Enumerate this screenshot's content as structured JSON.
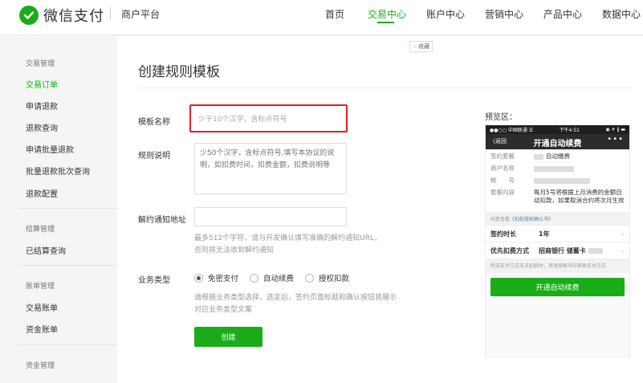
{
  "header": {
    "logo_text": "微信支付",
    "platform": "商户平台",
    "nav": [
      "首页",
      "交易中心",
      "账户中心",
      "营销中心",
      "产品中心",
      "数据中心"
    ],
    "active_nav": "交易中心"
  },
  "sidebar": {
    "sections": [
      {
        "heading": "交易管理",
        "items": [
          "交易订单",
          "申请退款",
          "退款查询",
          "申请批量退款",
          "批量退款批次查询",
          "退款配置"
        ]
      },
      {
        "heading": "结算管理",
        "items": [
          "已结算查询"
        ]
      },
      {
        "heading": "账单管理",
        "items": [
          "交易账单",
          "资金账单"
        ]
      },
      {
        "heading": "资金管理",
        "items": []
      }
    ],
    "active_item": "交易订单"
  },
  "main": {
    "favorite_label": "收藏",
    "title": "创建规则模板",
    "form": {
      "name_label": "模板名称",
      "name_placeholder": "少于10个汉字，含标点符号",
      "desc_label": "规则说明",
      "desc_placeholder": "少50个汉字，含标点符号,填写本协议的说明，如扣费时间，扣费金额，扣费说明等",
      "url_label": "解约通知地址",
      "url_value": "",
      "url_hint_1": "最多512个字符，请与开发确认填写准确的解约通知URL，",
      "url_hint_2": "否则将无法收到解约通知",
      "type_label": "业务类型",
      "type_options": [
        "免密支付",
        "自动续费",
        "授权扣款"
      ],
      "type_selected": "免密支付",
      "type_hint_1": "请根据业务类型选择，选定后，签约页面标题和确认按钮将展示",
      "type_hint_2": "对应业务类型文案",
      "create_button": "创建"
    }
  },
  "preview": {
    "label": "预览区：",
    "status_left": "●●○○ 中国联通 ☰",
    "status_time": "下午4:51",
    "status_right": "◉ ✈ ∦ ▬",
    "back": "〈返回",
    "title": "开通自动续费",
    "more": "•••",
    "rows": [
      {
        "k": "签约套餐",
        "v": "自动缴费"
      },
      {
        "k": "商户名称",
        "v": ""
      },
      {
        "k": "帐　　号",
        "v": ""
      },
      {
        "k": "套餐内容",
        "v": "每月5号将根据上月消费的金额自动扣款，如果取消合约将次月生效"
      }
    ],
    "link_text": "同意查看",
    "link_anchor": "《扣款授权确认书》",
    "duration_label": "签约时长",
    "duration_value": "1年",
    "priority_label": "优先扣费方式",
    "priority_value": "招商银行 储蓄卡",
    "note": "所选支付方式无法扣款时，将改用帐号中其他支付方式",
    "button": "开通自动续费"
  },
  "colors": {
    "brand_green": "#1aad19",
    "highlight_red": "#e21f1f"
  },
  "icons": {
    "logo": "wechat-pay-logo-icon",
    "favorite": "star-icon",
    "chevron": "chevron-right-icon"
  }
}
